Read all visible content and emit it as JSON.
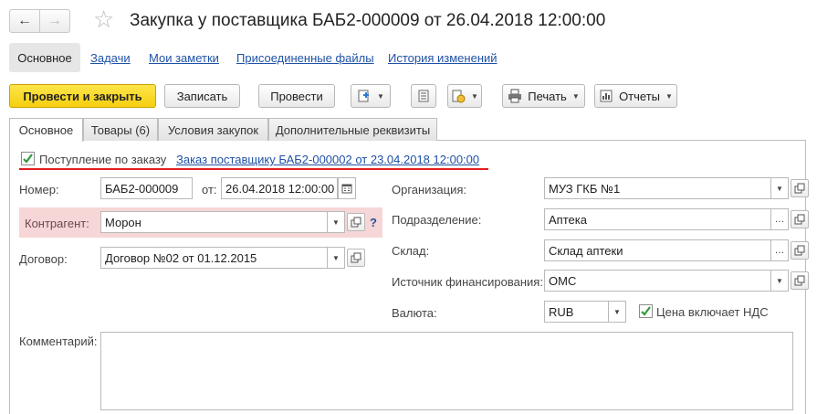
{
  "window": {
    "title": "Закупка у поставщика БАБ2-000009 от 26.04.2018 12:00:00"
  },
  "nav_links": {
    "main": "Основное",
    "tasks": "Задачи",
    "notes": "Мои заметки",
    "files": "Присоединенные файлы",
    "history": "История изменений"
  },
  "toolbar": {
    "post_close": "Провести и закрыть",
    "save": "Записать",
    "post": "Провести",
    "print": "Печать",
    "reports": "Отчеты"
  },
  "tabs": [
    {
      "label": "Основное"
    },
    {
      "label": "Товары (6)"
    },
    {
      "label": "Условия закупок"
    },
    {
      "label": "Дополнительные реквизиты"
    }
  ],
  "form": {
    "by_order_label": "Поступление по заказу",
    "by_order_checked": true,
    "order_link": "Заказ поставщику БАБ2-000002 от 23.04.2018 12:00:00",
    "number_label": "Номер:",
    "number_value": "БАБ2-000009",
    "date_label": "от:",
    "date_value": "26.04.2018 12:00:00",
    "counterparty_label": "Контрагент:",
    "counterparty_value": "Морон",
    "help_mark": "?",
    "contract_label": "Договор:",
    "contract_value": "Договор  №02 от 01.12.2015",
    "organization_label": "Организация:",
    "organization_value": "МУЗ ГКБ №1",
    "department_label": "Подразделение:",
    "department_value": "Аптека",
    "warehouse_label": "Склад:",
    "warehouse_value": "Склад аптеки",
    "funding_label": "Источник финансирования:",
    "funding_value": "ОМС",
    "currency_label": "Валюта:",
    "currency_value": "RUB",
    "vat_label": "Цена включает НДС",
    "vat_checked": true,
    "comment_label": "Комментарий:",
    "comment_value": ""
  },
  "colors": {
    "primary_button": "#f5cf0f",
    "link": "#1f52a5",
    "required_highlight": "#f6d6d6",
    "annotation_underline": "#e31e1e",
    "checkmark": "#2e9a3a"
  }
}
